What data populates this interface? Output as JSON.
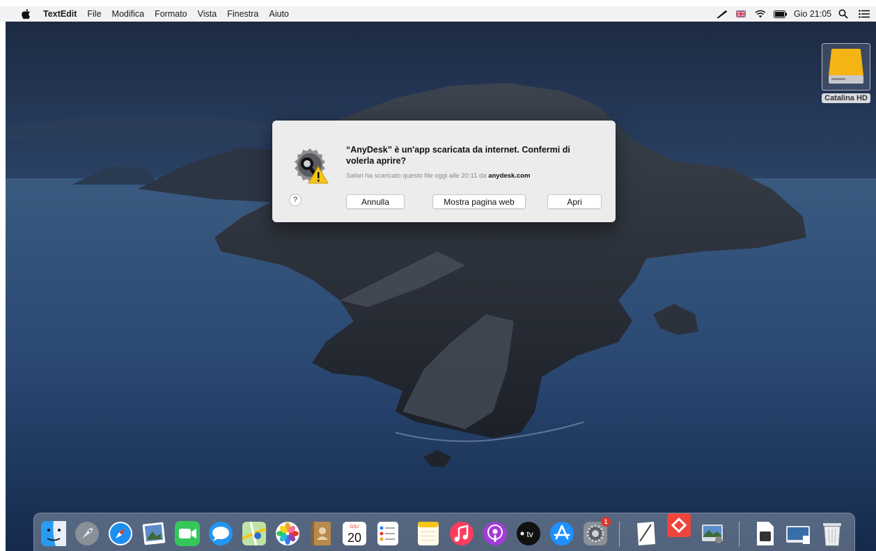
{
  "menubar": {
    "app_name": "TextEdit",
    "menus": [
      "File",
      "Modifica",
      "Formato",
      "Vista",
      "Finestra",
      "Aiuto"
    ],
    "clock": "Gio 21:05"
  },
  "desktop": {
    "drive_label": "Catalina HD"
  },
  "dialog": {
    "title": "“AnyDesk” è un'app scaricata da internet. Confermi di volerla aprire?",
    "subtitle": "Safari ha scaricato questo file oggi alle 20:11 da",
    "site": "anydesk.com",
    "help_label": "?",
    "buttons": {
      "cancel": "Annulla",
      "show_web": "Mostra pagina web",
      "open": "Apri"
    }
  },
  "dock": {
    "calendar_month": "GIU",
    "calendar_day": "20",
    "tv_label": "tv",
    "settings_badge": "1"
  },
  "colors": {
    "menubar_bg": "#f2f2f4",
    "dialog_bg": "#ececec",
    "warning_yellow": "#f5c518",
    "anydesk_red": "#ef443b"
  }
}
